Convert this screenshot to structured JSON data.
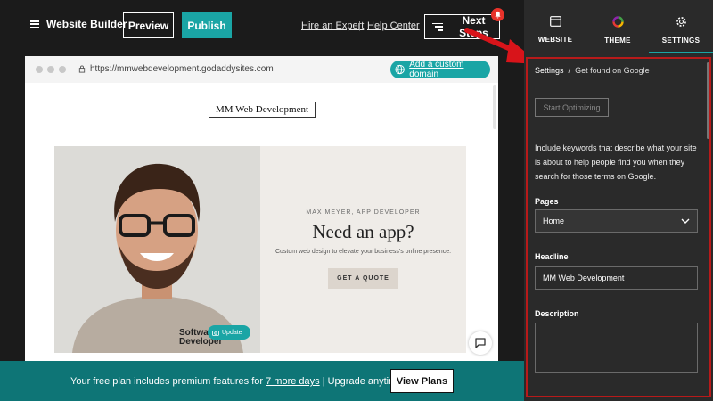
{
  "topbar": {
    "app_title": "Website Builder",
    "preview_label": "Preview",
    "publish_label": "Publish",
    "hire_expert_label": "Hire an Expert",
    "separator": "|",
    "help_center_label": "Help Center",
    "next_steps_label": "Next Steps"
  },
  "preview": {
    "url": "https://mmwebdevelopment.godaddysites.com",
    "add_domain_label": "Add a custom domain",
    "site_title": "MM Web Development",
    "hero": {
      "eyebrow": "MAX MEYER, APP DEVELOPER",
      "heading": "Need an app?",
      "subtext": "Custom web design to elevate your business's online presence.",
      "cta_label": "GET A QUOTE",
      "shirt_text_1": "Software",
      "shirt_text_2": "Developer",
      "update_label": "Update"
    }
  },
  "banner": {
    "text_before": "Your free plan includes premium features for",
    "link_text": "7 more days",
    "text_after": "| Upgrade anytime",
    "button_label": "View Plans"
  },
  "panel": {
    "tabs": [
      {
        "label": "WEBSITE",
        "icon": "browser-window-icon"
      },
      {
        "label": "THEME",
        "icon": "color-wheel-icon"
      },
      {
        "label": "SETTINGS",
        "icon": "gear-icon"
      }
    ],
    "active_tab": "SETTINGS",
    "breadcrumb_root": "Settings",
    "breadcrumb_sep": "/",
    "breadcrumb_current": "Get found on Google",
    "start_button": "Start Optimizing",
    "help_text": "Include keywords that describe what your site is about to help people find you when they search for those terms on Google.",
    "pages_label": "Pages",
    "pages_value": "Home",
    "headline_label": "Headline",
    "headline_value": "MM Web Development",
    "description_label": "Description",
    "description_value": ""
  },
  "colors": {
    "accent": "#1aa5a5",
    "banner": "#0e7576",
    "annotation": "#b81a1a",
    "notification": "#e8322a"
  }
}
